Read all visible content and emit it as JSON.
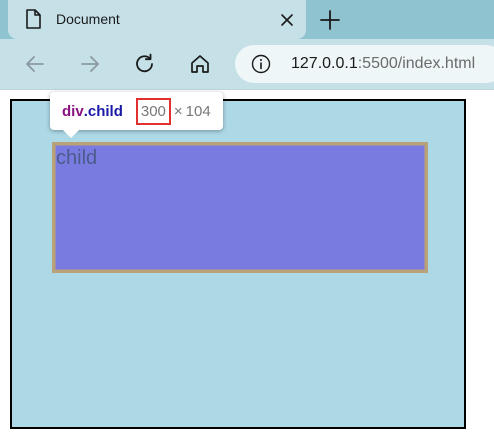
{
  "browser": {
    "tab": {
      "title": "Document",
      "icon": "document-icon"
    },
    "new_tab_icon": "plus-icon",
    "nav": {
      "back_icon": "arrow-left-icon",
      "forward_icon": "arrow-right-icon",
      "reload_icon": "reload-icon",
      "home_icon": "home-icon"
    },
    "address": {
      "host": "127.0.0.1",
      "port_path": ":5500/index.html",
      "info_icon": "info-icon"
    },
    "colors": {
      "tabstrip": "#8fc3cf",
      "toolbar": "#c5e1e7"
    }
  },
  "page": {
    "child_text": "child",
    "colors": {
      "parent_bg": "#add8e6",
      "parent_border": "#000000",
      "child_bg": "#7a7be0"
    }
  },
  "inspector": {
    "tag": "div",
    "class_name": ".child",
    "width": "300",
    "times": "×",
    "height": "104",
    "highlight_color": "#e03030"
  }
}
